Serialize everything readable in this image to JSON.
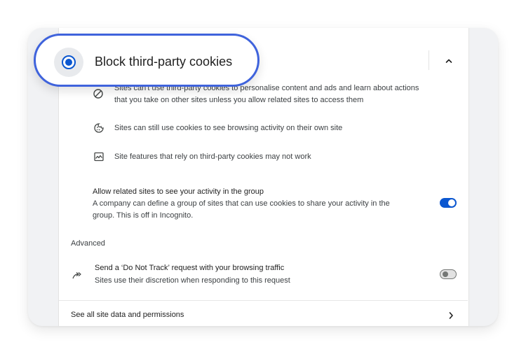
{
  "header": {
    "option_label": "Block third-party cookies"
  },
  "details": [
    {
      "icon": "blocked-icon",
      "text_line1": "Sites can't use third-party cookies to personalise content and ads and learn about actions",
      "text_line2": "that you take on other sites unless you allow related sites to access them"
    },
    {
      "icon": "cookie-icon",
      "text_line1": "Sites can still use cookies to see browsing activity on their own site"
    },
    {
      "icon": "image-broken-icon",
      "text_line1": "Site features that rely on third-party cookies may not work"
    }
  ],
  "related_sites": {
    "title": "Allow related sites to see your activity in the group",
    "description_line1": "A company can define a group of sites that can use cookies to share your activity in the",
    "description_line2": "group. This is off in Incognito.",
    "enabled": true
  },
  "advanced": {
    "heading": "Advanced",
    "dnt_title": "Send a ‘Do Not Track’ request with your browsing traffic",
    "dnt_description": "Sites use their discretion when responding to this request",
    "dnt_enabled": false
  },
  "footer": {
    "see_all_label": "See all site data and permissions"
  },
  "colors": {
    "accent": "#0b57d0",
    "highlight_border": "#3f63dc"
  }
}
